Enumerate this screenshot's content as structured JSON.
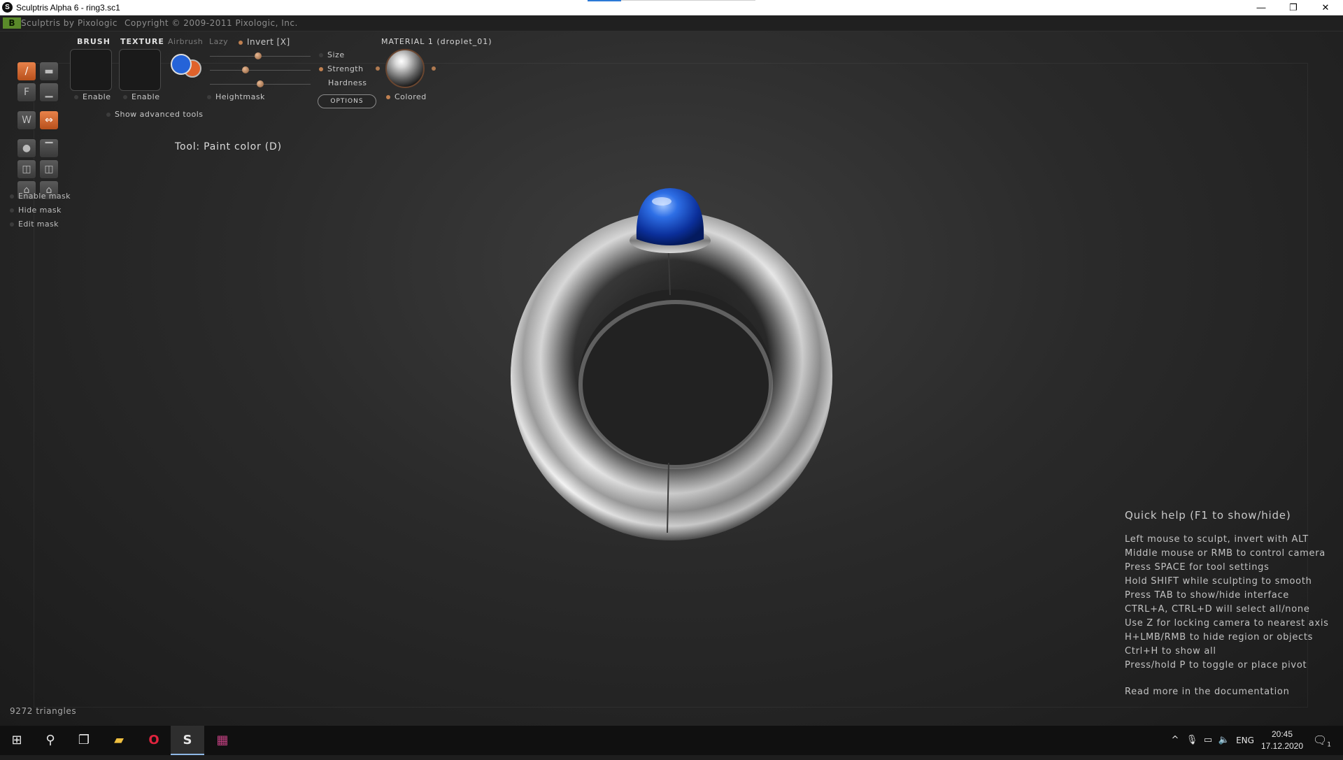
{
  "window": {
    "title": "Sculptris Alpha 6 - ring3.sc1",
    "controls": {
      "minimize": "—",
      "restore": "❐",
      "close": "✕"
    }
  },
  "menubar": {
    "logo_text": "B",
    "brand": "Sculptris by Pixologic",
    "copyright": "Copyright © 2009-2011 Pixologic, Inc."
  },
  "left_toolbar": {
    "tools": [
      {
        "icon": "draw-brush-icon",
        "glyph": "/",
        "active": true
      },
      {
        "icon": "inflate-icon",
        "glyph": "▬",
        "active": false
      },
      {
        "icon": "flatten-icon",
        "glyph": "F",
        "active": false
      },
      {
        "icon": "smooth-icon",
        "glyph": "▁",
        "active": false
      },
      {
        "icon": "crease-icon",
        "glyph": "W",
        "active": false
      },
      {
        "icon": "symmetry-icon",
        "glyph": "⇔",
        "active": true
      },
      {
        "icon": "sphere-icon",
        "glyph": "●",
        "active": false
      },
      {
        "icon": "plane-icon",
        "glyph": "▔",
        "active": false
      },
      {
        "icon": "grab-icon",
        "glyph": "◫",
        "active": false
      },
      {
        "icon": "rotate-icon",
        "glyph": "◫",
        "active": false
      },
      {
        "icon": "scale-icon",
        "glyph": "⌂",
        "active": false
      },
      {
        "icon": "pinch-icon",
        "glyph": "⌂",
        "active": false
      }
    ],
    "mask_options": [
      "Enable mask",
      "Hide mask",
      "Edit mask"
    ]
  },
  "brush_panel": {
    "brush_label": "BRUSH",
    "texture_label": "TEXTURE",
    "airbrush_label": "Airbrush",
    "lazy_label": "Lazy",
    "invert_label": "Invert [X]",
    "enable_label": "Enable",
    "texture_enable_label": "Enable",
    "heightmask_label": "Heightmask",
    "show_advanced_label": "Show advanced tools",
    "sliders": [
      {
        "label": "Size",
        "value": 0.5
      },
      {
        "label": "Strength",
        "value": 0.35
      },
      {
        "label": "Hardness",
        "value": 0.5
      }
    ],
    "options_label": "OPTIONS",
    "primary_color": "#2563d8",
    "secondary_color": "#e0622b"
  },
  "material": {
    "title": "MATERIAL 1 (droplet_01)",
    "colored_label": "Colored"
  },
  "tool_status": "Tool: Paint color (D)",
  "quick_help": {
    "title": "Quick help (F1 to show/hide)",
    "lines": [
      "Left mouse to sculpt, invert with ALT",
      "Middle mouse or RMB to control camera",
      "Press SPACE for tool settings",
      "Hold SHIFT while sculpting to smooth",
      "Press TAB to show/hide interface",
      "CTRL+A, CTRL+D will select all/none",
      "Use Z for locking camera to nearest axis",
      "H+LMB/RMB to hide region or objects",
      "Ctrl+H to show all",
      "Press/hold P to toggle or place pivot"
    ],
    "more": "Read more in the documentation"
  },
  "triangles": "9272 triangles",
  "taskbar": {
    "items": [
      {
        "icon": "windows-start-icon",
        "glyph": "⊞"
      },
      {
        "icon": "search-icon",
        "glyph": "⚲"
      },
      {
        "icon": "task-view-icon",
        "glyph": "❐"
      },
      {
        "icon": "file-explorer-icon",
        "glyph": "▰"
      },
      {
        "icon": "opera-icon",
        "glyph": "O"
      },
      {
        "icon": "sculptris-icon",
        "glyph": "S"
      },
      {
        "icon": "winrar-icon",
        "glyph": "▦"
      }
    ],
    "tray": {
      "chevron": "^",
      "language": "ENG",
      "time": "20:45",
      "date": "17.12.2020",
      "notification_count": "1"
    }
  }
}
